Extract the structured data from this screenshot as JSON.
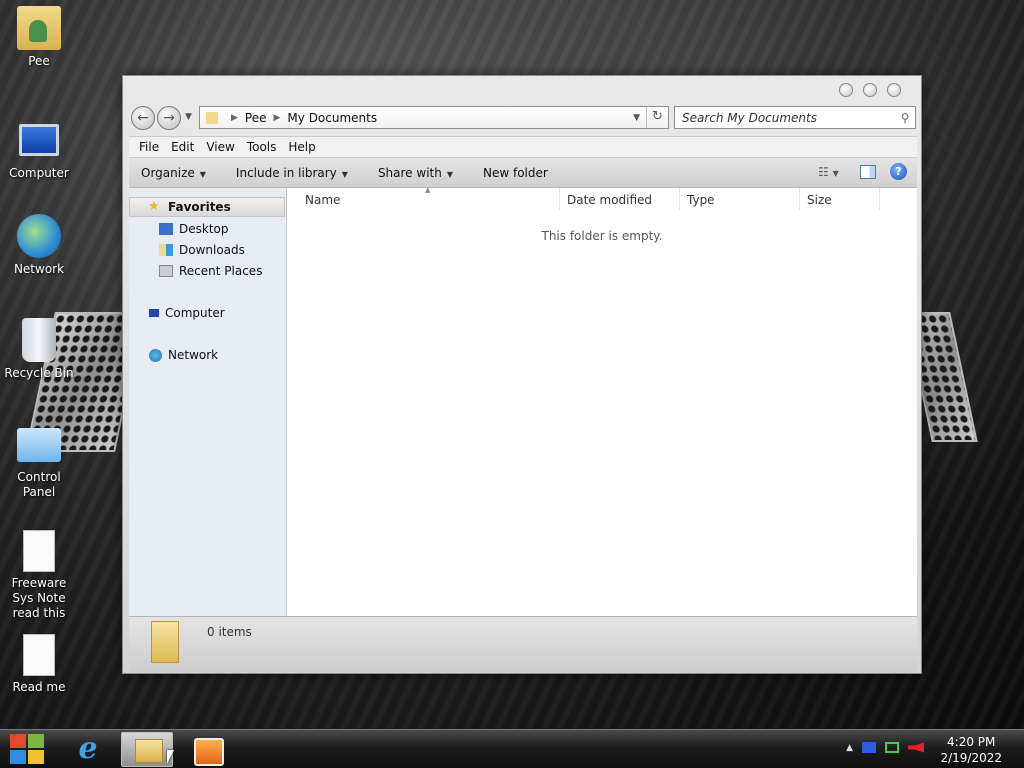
{
  "desktop": {
    "icons": [
      {
        "label": "Pee"
      },
      {
        "label": "Computer"
      },
      {
        "label": "Network"
      },
      {
        "label": "Recycle Bin"
      },
      {
        "label": "Control Panel"
      },
      {
        "label": "Freeware Sys Note read this"
      },
      {
        "label": "Read me"
      }
    ]
  },
  "explorer": {
    "address": {
      "segments": [
        "Pee",
        "My Documents"
      ]
    },
    "search": {
      "placeholder": "Search My Documents"
    },
    "menu": [
      "File",
      "Edit",
      "View",
      "Tools",
      "Help"
    ],
    "toolbar": {
      "organize": "Organize",
      "include_in_library": "Include in library",
      "share_with": "Share with",
      "new_folder": "New folder"
    },
    "nav_pane": {
      "favorites": "Favorites",
      "favorites_items": [
        "Desktop",
        "Downloads",
        "Recent Places"
      ],
      "computer": "Computer",
      "network": "Network"
    },
    "columns": [
      "Name",
      "Date modified",
      "Type",
      "Size"
    ],
    "empty_message": "This folder is empty.",
    "status": "0 items"
  },
  "taskbar": {
    "clock": {
      "time": "4:20 PM",
      "date": "2/19/2022"
    }
  },
  "icons": {
    "back": "back-arrow-icon",
    "forward": "forward-arrow-icon",
    "refresh": "refresh-icon",
    "search": "magnifier-icon",
    "help": "help-icon"
  }
}
